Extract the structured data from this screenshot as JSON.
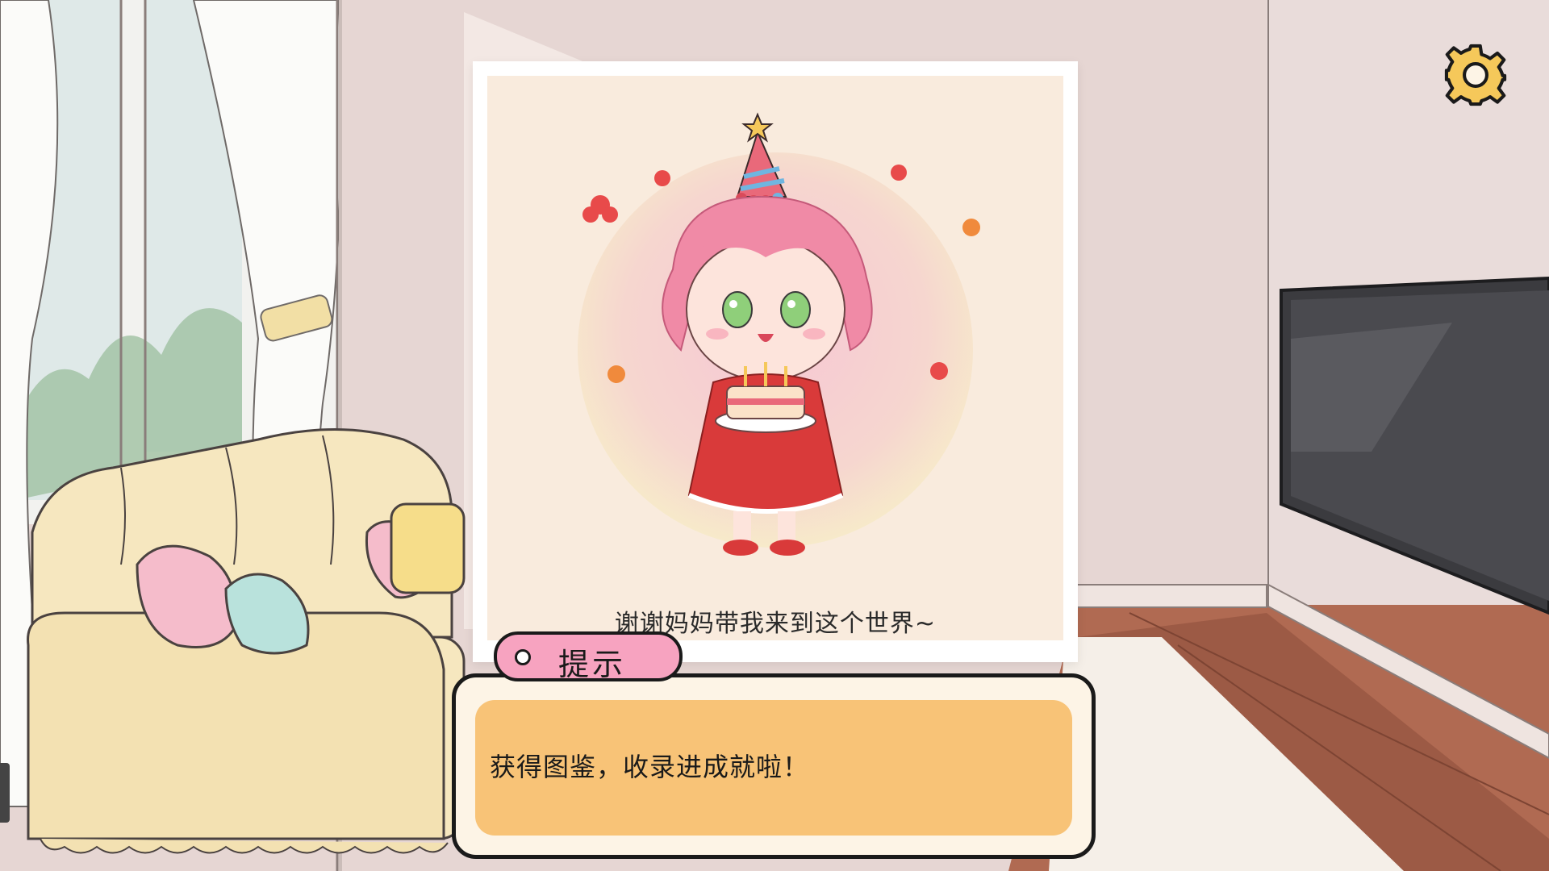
{
  "card": {
    "caption": "谢谢妈妈带我来到这个世界~"
  },
  "hint": {
    "title": "提示",
    "message": "获得图鉴，收录进成就啦！"
  },
  "icons": {
    "settings": "gear-icon"
  },
  "colors": {
    "hint_tab": "#f7a3c0",
    "dialog_inner": "#f8c377",
    "dialog_outer": "#fdf4e6",
    "gear_fill": "#f5c85a"
  }
}
